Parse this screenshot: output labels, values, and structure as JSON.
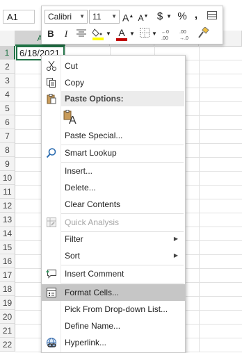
{
  "name_box": "A1",
  "columns": [
    {
      "label": "A",
      "selected": true
    },
    {
      "label": "",
      "selected": false
    },
    {
      "label": "",
      "selected": false
    },
    {
      "label": "",
      "selected": false
    },
    {
      "label": "",
      "selected": false
    }
  ],
  "rows": [
    "1",
    "2",
    "3",
    "4",
    "5",
    "6",
    "7",
    "8",
    "9",
    "10",
    "11",
    "12",
    "13",
    "14",
    "15",
    "16",
    "17",
    "18",
    "19",
    "20",
    "21",
    "22"
  ],
  "cell_a1": "6/18/2021",
  "mini_toolbar": {
    "font": "Calibri",
    "size": "11",
    "grow_font": "A",
    "shrink_font": "A",
    "currency": "$",
    "percent": "%",
    "comma": ",",
    "bold": "B",
    "italic": "I",
    "font_color": "A",
    "font_color_hex": "#c00000",
    "fill_color_hex": "#ffff00"
  },
  "menu": {
    "cut": "Cut",
    "copy": "Copy",
    "paste_options": "Paste Options:",
    "paste_glyph": "A",
    "paste_special": "Paste Special...",
    "smart_lookup": "Smart Lookup",
    "insert": "Insert...",
    "delete": "Delete...",
    "clear_contents": "Clear Contents",
    "quick_analysis": "Quick Analysis",
    "filter": "Filter",
    "sort": "Sort",
    "insert_comment": "Insert Comment",
    "format_cells": "Format Cells...",
    "pick_from_list": "Pick From Drop-down List...",
    "define_name": "Define Name...",
    "hyperlink": "Hyperlink..."
  },
  "colors": {
    "accent": "#217346",
    "menu_hover": "#c6c6c6"
  }
}
